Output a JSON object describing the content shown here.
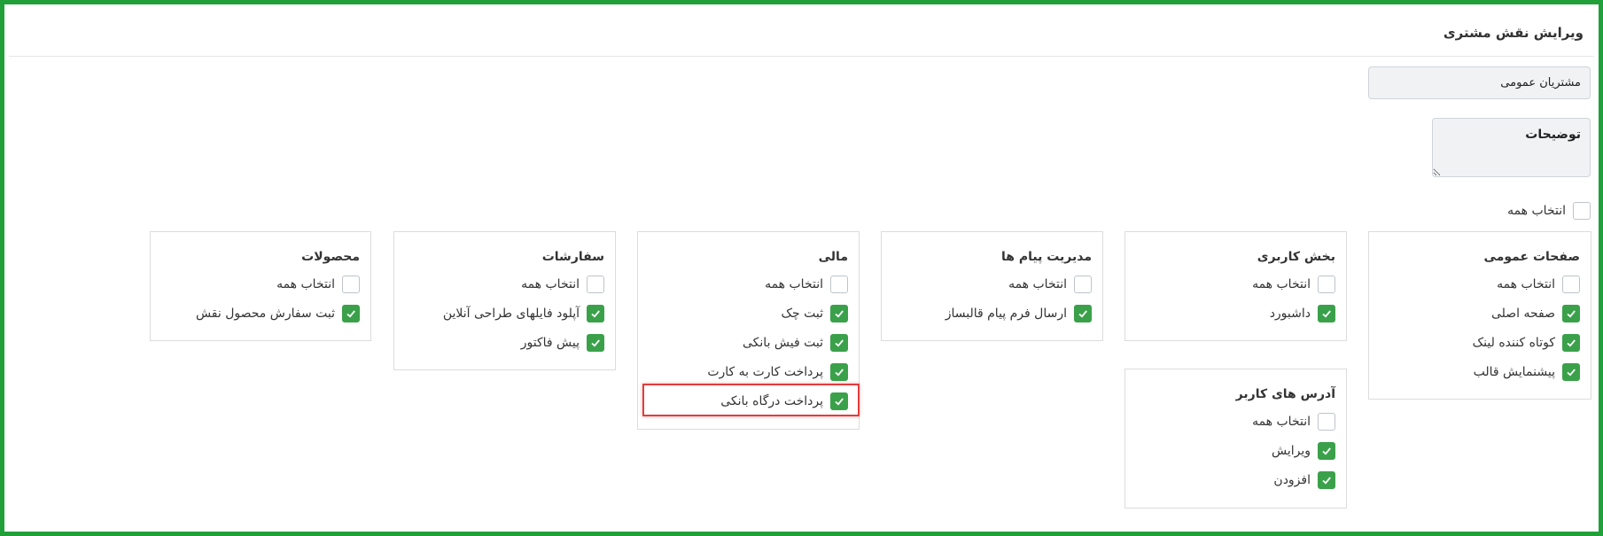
{
  "header": {
    "title": "ویرایش نقش مشتری"
  },
  "form": {
    "name_value": "مشتریان عمومی",
    "description_placeholder": "توضیحات",
    "select_all_label": "انتخاب همه"
  },
  "colors": {
    "frame": "#21a03a",
    "checkbox_checked": "#3aa14a",
    "highlight": "#e23c3c"
  },
  "sections": [
    {
      "title": "صفحات عمومی",
      "select_all": "انتخاب همه",
      "items": [
        {
          "label": "صفحه اصلی",
          "checked": true
        },
        {
          "label": "کوتاه کننده لینک",
          "checked": true
        },
        {
          "label": "پیشنمایش قالب",
          "checked": true
        }
      ]
    },
    {
      "title": "بخش کاربری",
      "select_all": "انتخاب همه",
      "items": [
        {
          "label": "داشبورد",
          "checked": true
        }
      ]
    },
    {
      "title": "مدیریت پیام ها",
      "select_all": "انتخاب همه",
      "items": [
        {
          "label": "ارسال فرم پیام قالبساز",
          "checked": true
        }
      ]
    },
    {
      "title": "مالی",
      "select_all": "انتخاب همه",
      "items": [
        {
          "label": "ثبت چک",
          "checked": true
        },
        {
          "label": "ثبت فیش بانکی",
          "checked": true
        },
        {
          "label": "پرداخت کارت به کارت",
          "checked": true
        },
        {
          "label": "پرداخت درگاه بانکی",
          "checked": true
        }
      ]
    },
    {
      "title": "سفارشات",
      "select_all": "انتخاب همه",
      "items": [
        {
          "label": "آپلود فایلهای طراحی آنلاین",
          "checked": true
        },
        {
          "label": "پیش فاکتور",
          "checked": true
        }
      ]
    },
    {
      "title": "محصولات",
      "select_all": "انتخاب همه",
      "items": [
        {
          "label": "ثبت سفارش محصول نقش",
          "checked": true
        }
      ]
    },
    {
      "title": "آدرس های کاربر",
      "select_all": "انتخاب همه",
      "items": [
        {
          "label": "ویرایش",
          "checked": true
        },
        {
          "label": "افزودن",
          "checked": true
        }
      ]
    }
  ]
}
